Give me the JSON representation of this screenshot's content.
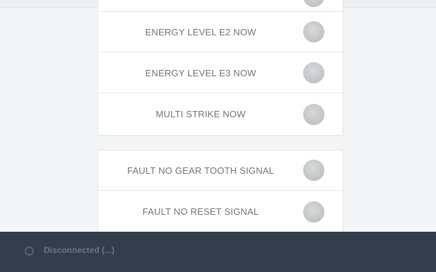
{
  "signals_group_1": [
    {
      "label": ""
    },
    {
      "label": "ENERGY LEVEL E2 NOW"
    },
    {
      "label": "ENERGY LEVEL E3 NOW"
    },
    {
      "label": "MULTI STRIKE NOW"
    }
  ],
  "signals_group_2": [
    {
      "label": "FAULT NO GEAR TOOTH SIGNAL"
    },
    {
      "label": "FAULT NO RESET SIGNAL"
    }
  ],
  "status": {
    "text": "Disconnected (...)"
  },
  "colors": {
    "indicator_inactive": "#c6c7c9",
    "statusbar_bg": "#343d4b"
  }
}
